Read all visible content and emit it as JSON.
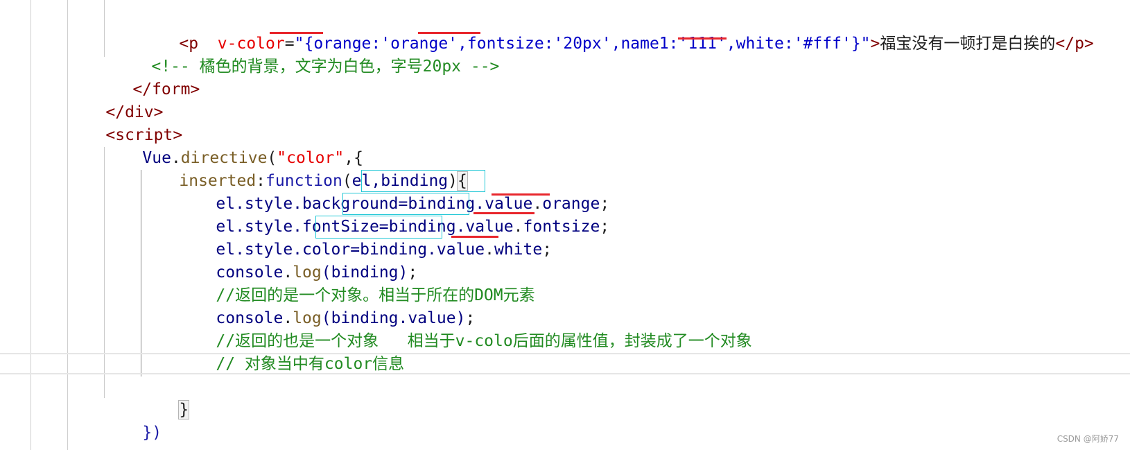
{
  "code": {
    "line1": {
      "open": "<p",
      "attr": "v-color",
      "eq": "=",
      "q1": "\"",
      "brace1": "{",
      "k1": "orange",
      "c1": ":'orange',",
      "k2": "fontsize",
      "c2": ":'20px',name1:'111',",
      "k3": "white",
      "c3": ":'#fff'",
      "brace2": "}",
      "q2": "\"",
      "gt": ">",
      "text": "福宝没有一顿打是白挨的",
      "close": "</p>"
    },
    "line2": "<!-- 橘色的背景，文字为白色，字号20px -->",
    "line3": "</form>",
    "line4": "</div>",
    "line5": "<script>",
    "line6": {
      "obj": "Vue",
      "dot": ".",
      "method": "directive",
      "p1": "(",
      "arg": "\"color\"",
      "rest": ",{"
    },
    "line7": {
      "key": "inserted",
      "colon": ":",
      "kw": "function",
      "paren": "(",
      "params": "el,binding",
      "paren2": ")",
      "brace": "{"
    },
    "line8": {
      "lhs": "el.style.background=",
      "bv": "binding.value",
      "dot": ".",
      "prop": "orange",
      "semi": ";"
    },
    "line9": {
      "lhs": "el.style.fontSize=",
      "bv": "binding.value",
      "dot": ".",
      "prop": "fontsize",
      "semi": ";"
    },
    "line10": {
      "lhs": "el.style.color=",
      "bv": "binding.value",
      "dot": ".",
      "prop": "white",
      "semi": ";"
    },
    "line11": {
      "obj": "console",
      "dot": ".",
      "method": "log",
      "args": "(binding)",
      "semi": ";"
    },
    "line12": "//返回的是一个对象。相当于所在的DOM元素",
    "line13": {
      "obj": "console",
      "dot": ".",
      "method": "log",
      "args": "(binding.value)",
      "semi": ";"
    },
    "line14": "//返回的也是一个对象   相当于v-colo后面的属性值，封装成了一个对象",
    "line15": "// 对象当中有color信息",
    "line17": "}",
    "line18": "})"
  },
  "watermark": "CSDN @阿娇77",
  "colors": {
    "underline": "#e8262c",
    "box": "#21c7d6",
    "tag": "#800000",
    "attr": "#e60000",
    "comment": "#228b22"
  }
}
